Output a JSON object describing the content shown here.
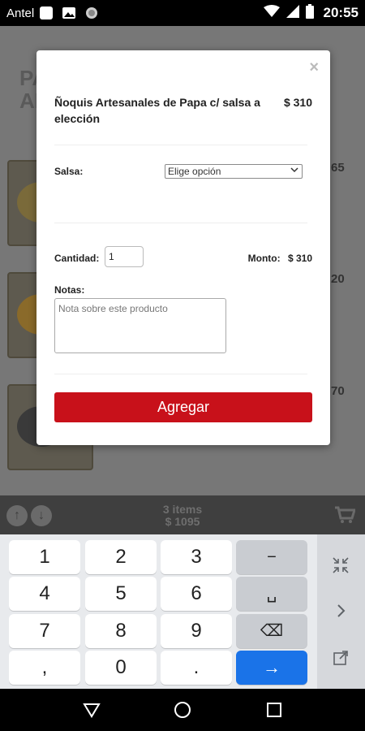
{
  "status_bar": {
    "carrier": "Antel",
    "time": "20:55"
  },
  "background": {
    "title_line1": "PA",
    "title_line2": "AL",
    "prices": [
      "65",
      "20",
      "70"
    ]
  },
  "cart_bar": {
    "items": "3 items",
    "total": "$ 1095"
  },
  "modal": {
    "product_name": "Ñoquis Artesanales de Papa c/ salsa a elección",
    "product_price": "$ 310",
    "close_symbol": "×",
    "salsa_label": "Salsa:",
    "salsa_selected": "Elige opción",
    "quantity_label": "Cantidad:",
    "quantity_value": "1",
    "monto_label": "Monto:",
    "monto_value": "$ 310",
    "notes_label": "Notas:",
    "notes_placeholder": "Nota sobre este producto",
    "add_button": "Agregar",
    "accent_color": "#c8111a"
  },
  "keyboard": {
    "rows": [
      [
        "1",
        "2",
        "3",
        "−"
      ],
      [
        "4",
        "5",
        "6",
        "␣"
      ],
      [
        "7",
        "8",
        "9",
        "⌫"
      ],
      [
        ",",
        "0",
        ".",
        "→"
      ]
    ],
    "side_icons": [
      "collapse-icon",
      "chevron-right-icon",
      "open-external-icon"
    ]
  }
}
